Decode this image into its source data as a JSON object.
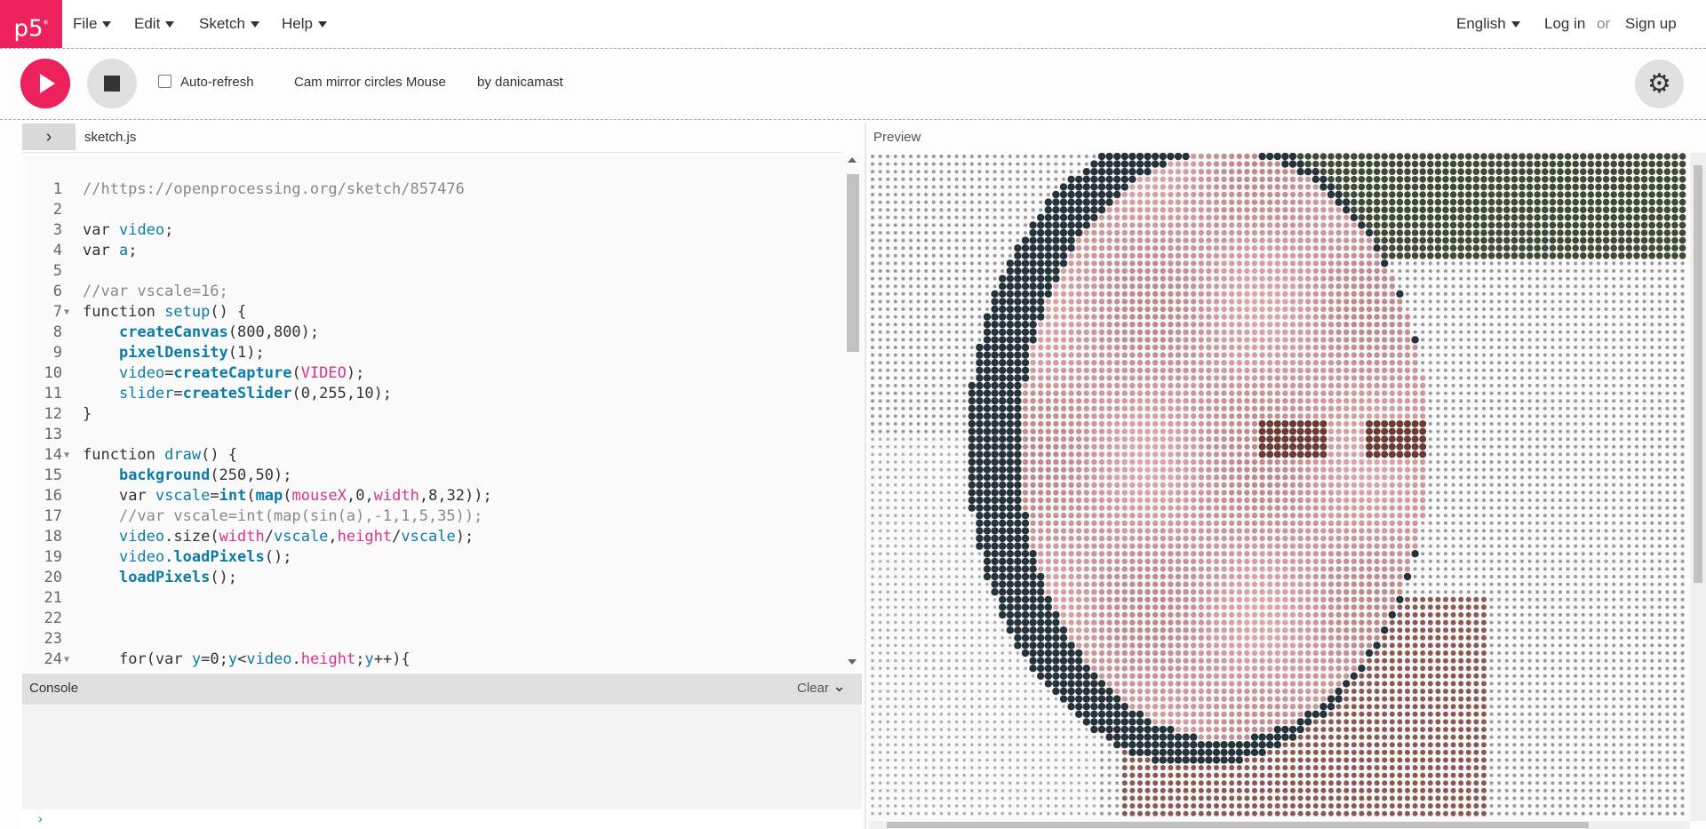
{
  "nav": {
    "logo": "p5",
    "logo_sup": "*",
    "menu": [
      "File",
      "Edit",
      "Sketch",
      "Help"
    ],
    "language": "English",
    "login": "Log in",
    "or": "or",
    "signup": "Sign up"
  },
  "toolbar": {
    "autorefresh_label": "Auto-refresh",
    "autorefresh_checked": false,
    "sketch_name": "Cam mirror circles Mouse",
    "author": "by danicamast"
  },
  "editor": {
    "file": "sketch.js",
    "preview_label": "Preview",
    "lines": [
      {
        "n": "1",
        "text": "//https://openprocessing.org/sketch/857476"
      },
      {
        "n": "2",
        "text": ""
      },
      {
        "n": "3",
        "text": "var video;"
      },
      {
        "n": "4",
        "text": "var a;"
      },
      {
        "n": "5",
        "text": ""
      },
      {
        "n": "6",
        "text": "//var vscale=16;"
      },
      {
        "n": "7",
        "text": "function setup() {",
        "fold": true
      },
      {
        "n": "8",
        "text": "    createCanvas(800,800);"
      },
      {
        "n": "9",
        "text": "    pixelDensity(1);"
      },
      {
        "n": "10",
        "text": "    video=createCapture(VIDEO);"
      },
      {
        "n": "11",
        "text": "    slider=createSlider(0,255,10);"
      },
      {
        "n": "12",
        "text": "}"
      },
      {
        "n": "13",
        "text": ""
      },
      {
        "n": "14",
        "text": "function draw() {",
        "fold": true
      },
      {
        "n": "15",
        "text": "    background(250,50);"
      },
      {
        "n": "16",
        "text": "    var vscale=int(map(mouseX,0,width,8,32));"
      },
      {
        "n": "17",
        "text": "    //var vscale=int(map(sin(a),-1,1,5,35));"
      },
      {
        "n": "18",
        "text": "    video.size(width/vscale,height/vscale);"
      },
      {
        "n": "19",
        "text": "    video.loadPixels();"
      },
      {
        "n": "20",
        "text": "    loadPixels();"
      },
      {
        "n": "21",
        "text": ""
      },
      {
        "n": "22",
        "text": ""
      },
      {
        "n": "23",
        "text": ""
      },
      {
        "n": "24",
        "text": "    for(var y=0;y<video.height;y++){",
        "fold": true
      }
    ]
  },
  "console": {
    "title": "Console",
    "clear": "Clear",
    "prompt": "›"
  },
  "colors": {
    "accent": "#ed225d",
    "keyword": "#0b7ca9",
    "string_const": "#d9328f",
    "comment": "#888888"
  }
}
